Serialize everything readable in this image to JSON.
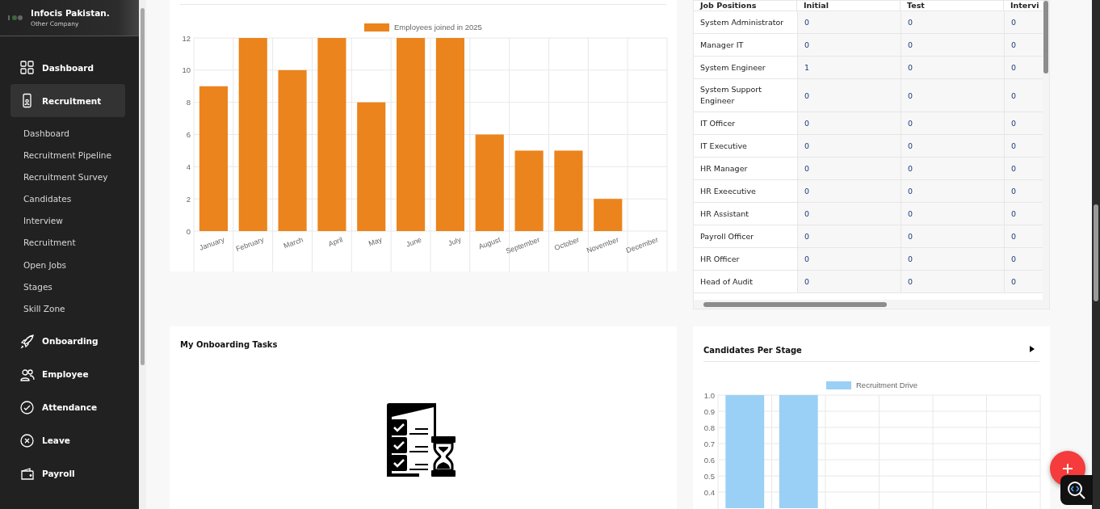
{
  "company": {
    "name": "Infocis Pakistan.",
    "subtitle": "Other Company"
  },
  "sidebar": {
    "items": [
      {
        "label": "Dashboard",
        "selected": false
      },
      {
        "label": "Recruitment",
        "selected": true,
        "children": [
          {
            "label": "Dashboard"
          },
          {
            "label": "Recruitment Pipeline"
          },
          {
            "label": "Recruitment Survey"
          },
          {
            "label": "Candidates"
          },
          {
            "label": "Interview"
          },
          {
            "label": "Recruitment"
          },
          {
            "label": "Open Jobs"
          },
          {
            "label": "Stages"
          },
          {
            "label": "Skill Zone"
          }
        ]
      },
      {
        "label": "Onboarding",
        "selected": false
      },
      {
        "label": "Employee",
        "selected": false
      },
      {
        "label": "Attendance",
        "selected": false
      },
      {
        "label": "Leave",
        "selected": false
      },
      {
        "label": "Payroll",
        "selected": false
      }
    ]
  },
  "employees_chart": {
    "chart_data": {
      "type": "bar",
      "categories": [
        "January",
        "February",
        "March",
        "April",
        "May",
        "June",
        "July",
        "August",
        "September",
        "October",
        "November",
        "December"
      ],
      "series": [
        {
          "name": "Employees joined in 2025",
          "color": "#eb841c",
          "values": [
            9,
            12,
            10,
            12,
            8,
            12,
            12,
            6,
            5,
            5,
            2,
            0
          ]
        }
      ],
      "ylim": [
        0,
        12
      ],
      "yticks": [
        0,
        2,
        4,
        6,
        8,
        10,
        12
      ],
      "grid": true
    }
  },
  "job_table": {
    "columns": [
      "Job Positions",
      "Initial",
      "Test",
      "Intervi"
    ],
    "rows": [
      {
        "position": "System Administrator",
        "values": [
          "0",
          "0",
          "0"
        ]
      },
      {
        "position": "Manager IT",
        "values": [
          "0",
          "0",
          "0"
        ]
      },
      {
        "position": "System Engineer",
        "values": [
          "1",
          "0",
          "0"
        ]
      },
      {
        "position": "System Support Engineer",
        "values": [
          "0",
          "0",
          "0"
        ]
      },
      {
        "position": "IT Officer",
        "values": [
          "0",
          "0",
          "0"
        ]
      },
      {
        "position": "IT Executive",
        "values": [
          "0",
          "0",
          "0"
        ]
      },
      {
        "position": "HR Manager",
        "values": [
          "0",
          "0",
          "0"
        ]
      },
      {
        "position": "HR Exeecutive",
        "values": [
          "0",
          "0",
          "0"
        ]
      },
      {
        "position": "HR Assistant",
        "values": [
          "0",
          "0",
          "0"
        ]
      },
      {
        "position": "Payroll Officer",
        "values": [
          "0",
          "0",
          "0"
        ]
      },
      {
        "position": "HR Officer",
        "values": [
          "0",
          "0",
          "0"
        ]
      },
      {
        "position": "Head of Audit",
        "values": [
          "0",
          "0",
          "0"
        ]
      }
    ]
  },
  "onboarding": {
    "title": "My Onboarding Tasks"
  },
  "stages": {
    "title": "Candidates Per Stage",
    "chart_data": {
      "type": "bar",
      "series": [
        {
          "name": "Recruitment Drive",
          "color": "#9ad0f5",
          "values": [
            1,
            1,
            null,
            null,
            null,
            null
          ]
        }
      ],
      "ylim": [
        0.3,
        1.0
      ],
      "yticks": [
        0.4,
        0.5,
        0.6,
        0.7,
        0.8,
        0.9,
        {
          "value": 1,
          "label": "1.0"
        }
      ],
      "grid": true
    }
  }
}
